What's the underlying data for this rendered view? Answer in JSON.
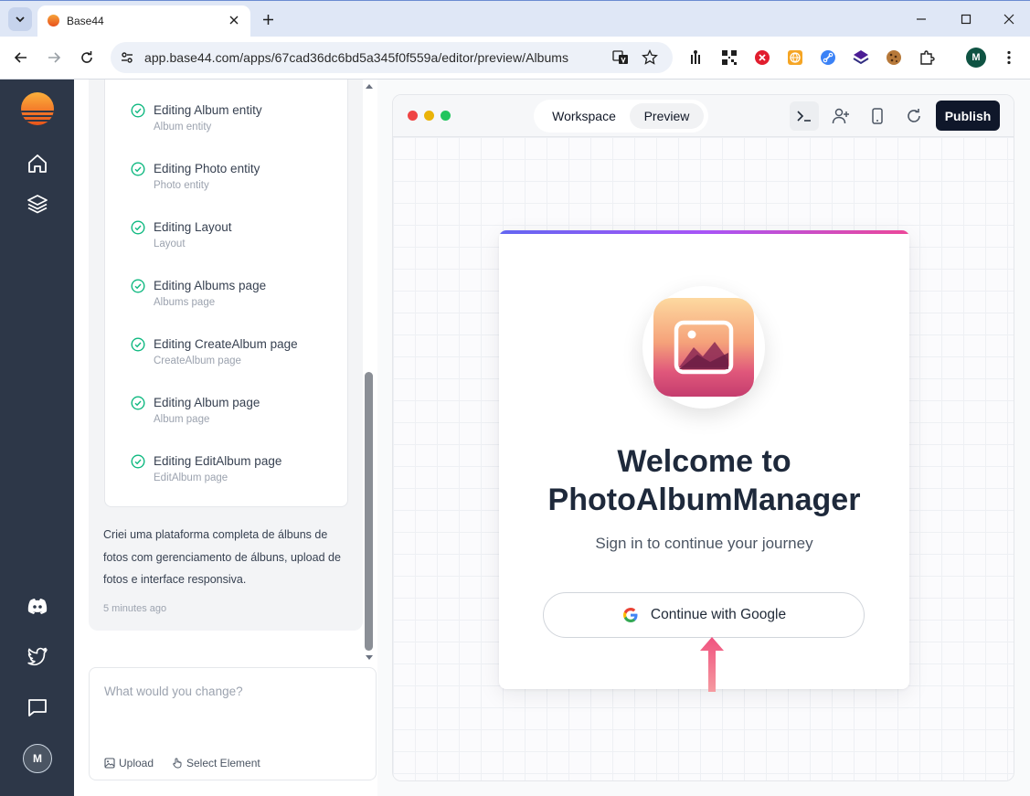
{
  "browser": {
    "tab_title": "Base44",
    "url": "app.base44.com/apps/67cad36dc6bd5a345f0f559a/editor/preview/Albums",
    "profile_initial": "M"
  },
  "sidebar": {
    "user_initial": "M"
  },
  "chat": {
    "steps": [
      {
        "title": "Editing Album entity",
        "subtitle": "Album entity"
      },
      {
        "title": "Editing Photo entity",
        "subtitle": "Photo entity"
      },
      {
        "title": "Editing Layout",
        "subtitle": "Layout"
      },
      {
        "title": "Editing Albums page",
        "subtitle": "Albums page"
      },
      {
        "title": "Editing CreateAlbum page",
        "subtitle": "CreateAlbum page"
      },
      {
        "title": "Editing Album page",
        "subtitle": "Album page"
      },
      {
        "title": "Editing EditAlbum page",
        "subtitle": "EditAlbum page"
      }
    ],
    "message": "Criei uma plataforma completa de álbuns de fotos com gerenciamento de álbuns, upload de fotos e interface responsiva.",
    "timestamp": "5 minutes ago",
    "composer": {
      "placeholder": "What would you change?",
      "upload_label": "Upload",
      "select_label": "Select Element"
    }
  },
  "preview": {
    "tabs": {
      "workspace": "Workspace",
      "preview": "Preview"
    },
    "active_tab": "Preview",
    "publish_label": "Publish",
    "login": {
      "title_line1": "Welcome to",
      "title_line2": "PhotoAlbumManager",
      "subtitle": "Sign in to continue your journey",
      "google_button": "Continue with Google"
    }
  },
  "colors": {
    "sidebar_bg": "#2d3748",
    "publish_bg": "#0f172a",
    "accent_gradient_start": "#6366f1",
    "accent_gradient_end": "#ec4899",
    "check_green": "#10b981",
    "arrow_pink": "#f0527f"
  },
  "icons": {
    "sidebar": [
      "home-icon",
      "layers-icon",
      "discord-icon",
      "twitter-icon",
      "chat-bubble-icon"
    ],
    "preview_toolbar": [
      "terminal-icon",
      "add-user-icon",
      "mobile-device-icon",
      "refresh-icon"
    ]
  }
}
